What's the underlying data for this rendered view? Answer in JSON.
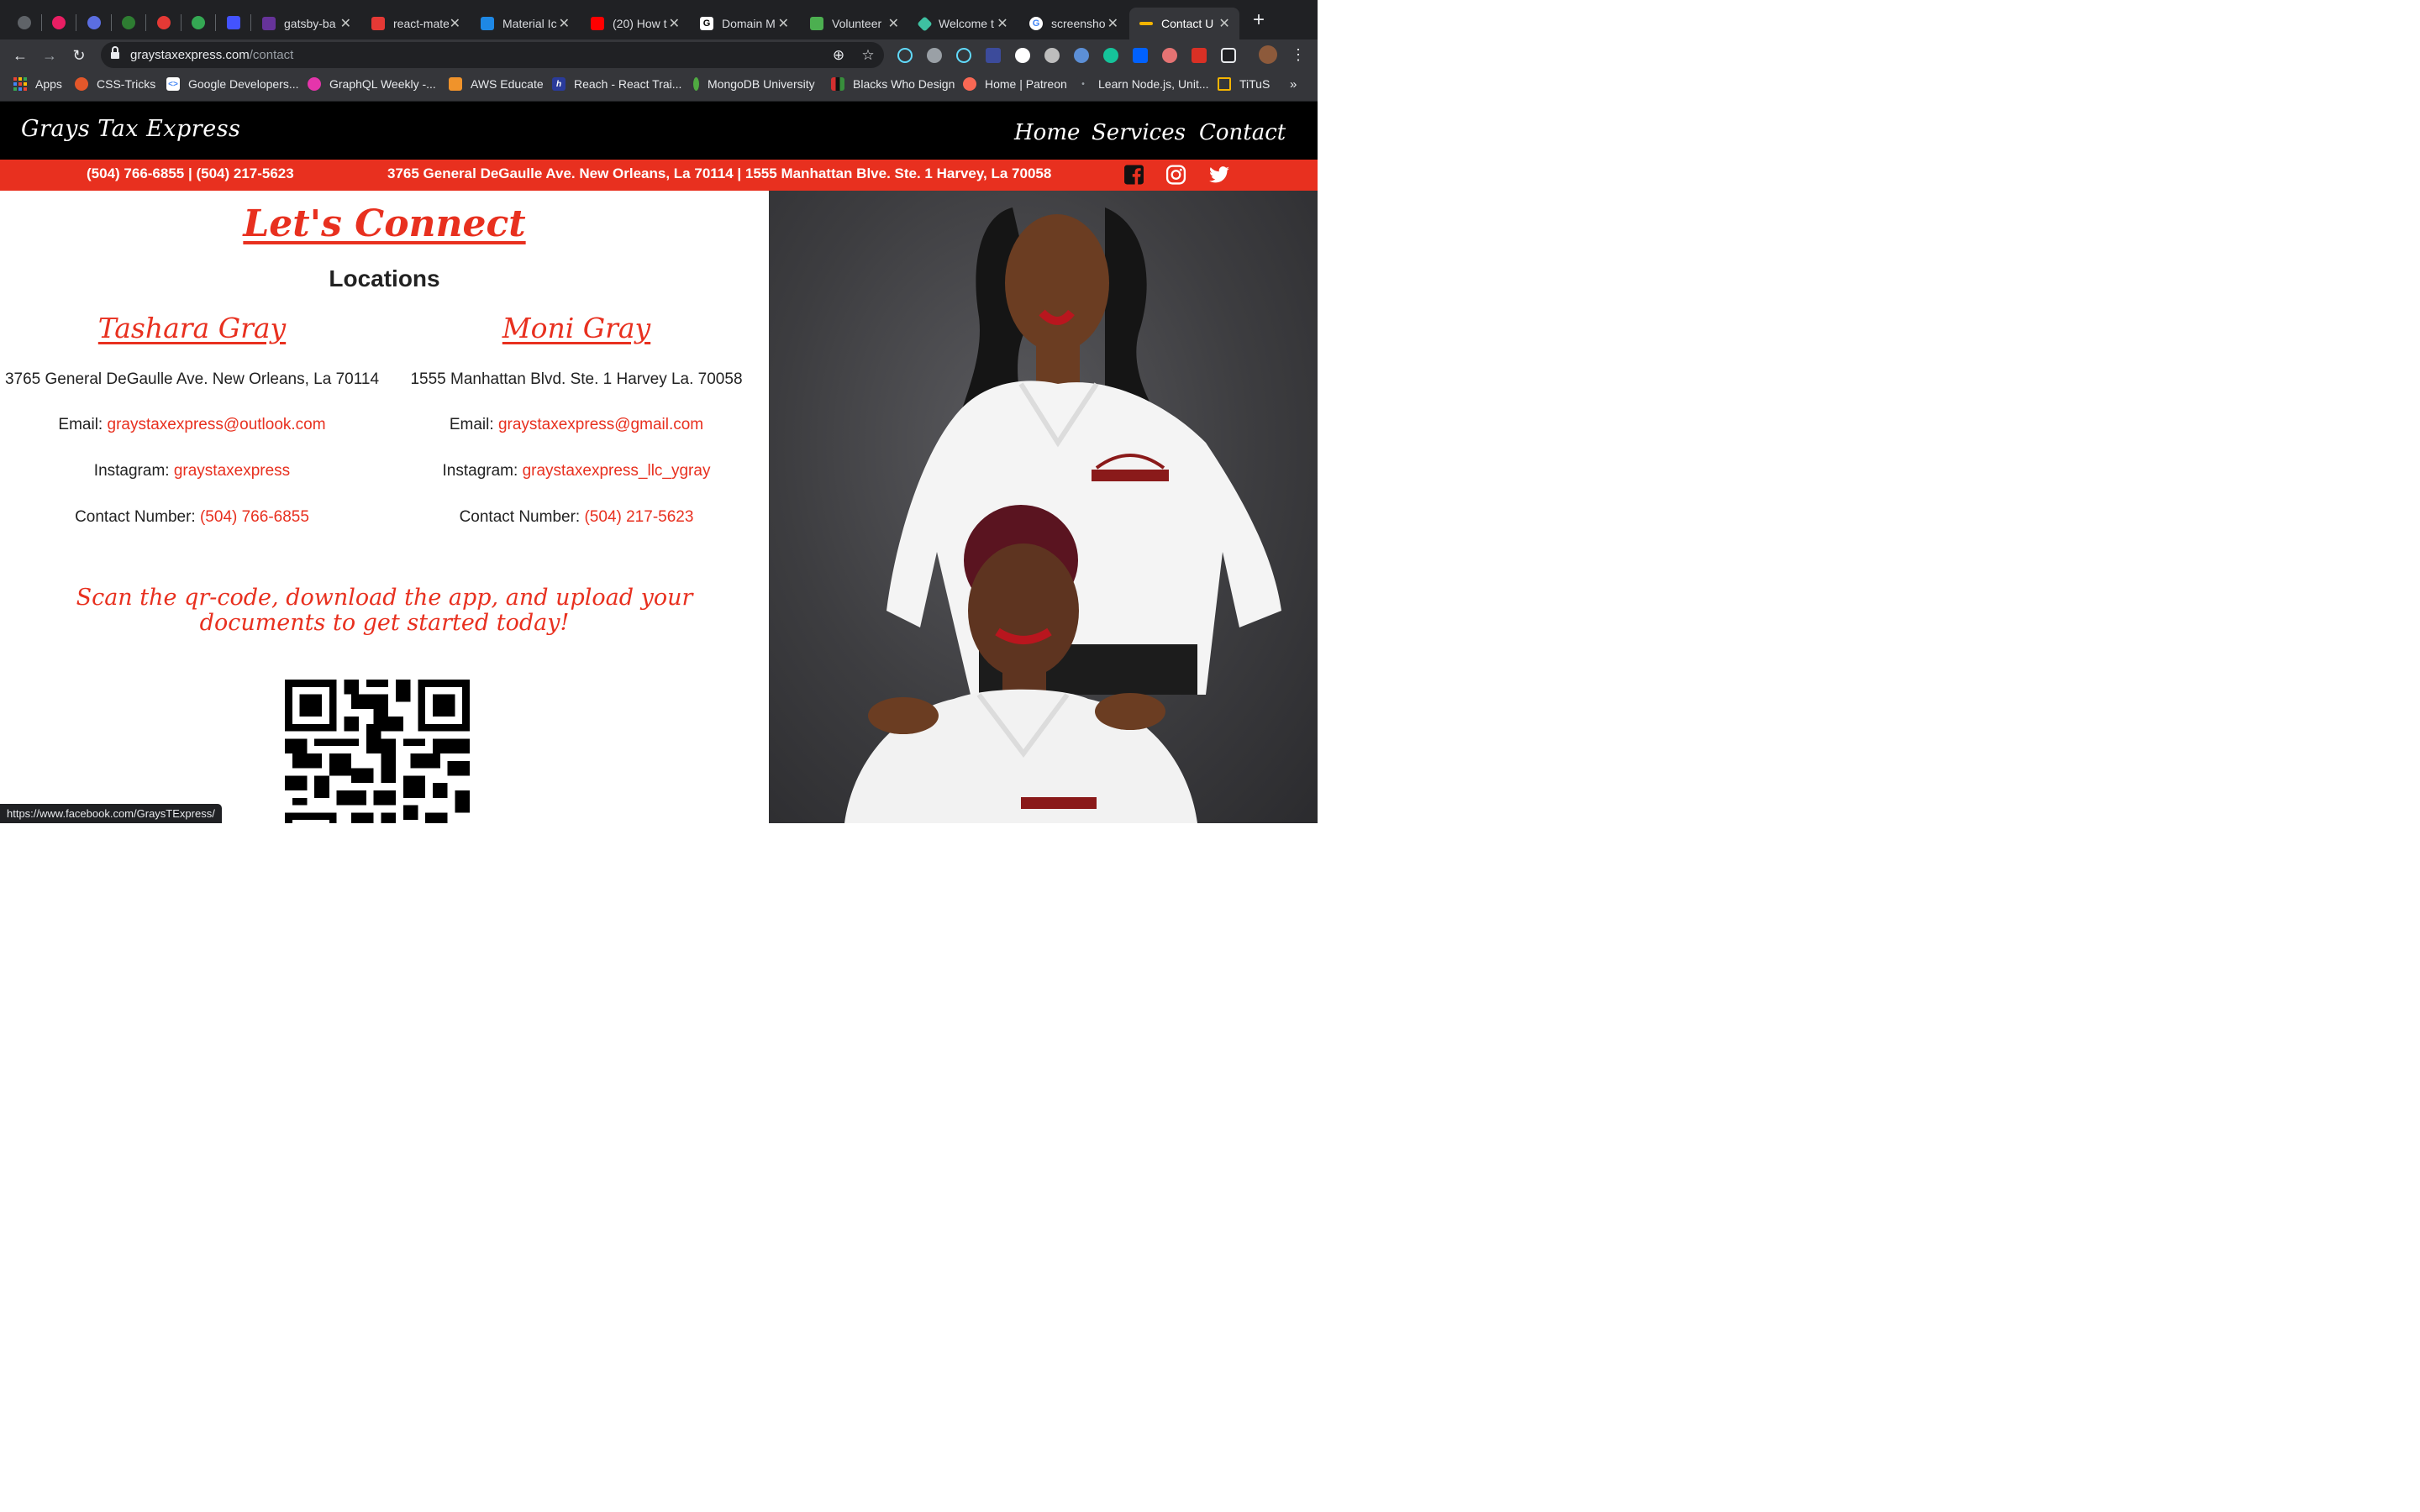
{
  "browser": {
    "tabs": [
      {
        "title": "gatsby-ba",
        "color": "#663399"
      },
      {
        "title": "react-mate",
        "color": "#e53935"
      },
      {
        "title": "Material Ic",
        "color": "#1e88e5"
      },
      {
        "title": "(20) How t",
        "color": "#ff0000"
      },
      {
        "title": "Domain M",
        "color": "#ffffff"
      },
      {
        "title": "Volunteer",
        "color": "#4caf50"
      },
      {
        "title": "Welcome t",
        "color": "#3ec1a2"
      },
      {
        "title": "screensho",
        "color": "#ffffff"
      },
      {
        "title": "Contact U",
        "color": "#f4b400"
      }
    ],
    "new_tab_label": "+",
    "url_host": "graystaxexpress.com",
    "url_path": "/contact",
    "bookmarks": [
      {
        "label": "Apps"
      },
      {
        "label": "CSS-Tricks"
      },
      {
        "label": "Google Developers..."
      },
      {
        "label": "GraphQL Weekly -..."
      },
      {
        "label": "AWS Educate"
      },
      {
        "label": "Reach - React Trai..."
      },
      {
        "label": "MongoDB University"
      },
      {
        "label": "Blacks Who Design"
      },
      {
        "label": "Home | Patreon"
      },
      {
        "label": "Learn Node.js, Unit..."
      },
      {
        "label": "TiTuS"
      }
    ],
    "bookmarks_overflow": "»",
    "status_url": "https://www.facebook.com/GraysTExpress/"
  },
  "site": {
    "logo": "Grays Tax Express",
    "nav": [
      {
        "label": "Home"
      },
      {
        "label": "Services"
      },
      {
        "label": "Contact"
      }
    ],
    "info_phones": "(504) 766-6855 | (504) 217-5623",
    "info_address": "3765 General DeGaulle Ave. New Orleans, La 70114 | 1555 Manhattan Blve. Ste. 1 Harvey, La 70058",
    "colors": {
      "accent": "#e8301f",
      "header": "#000000"
    }
  },
  "contact": {
    "title": "Let's Connect",
    "locations_heading": "Locations",
    "locations": [
      {
        "name": "Tashara Gray",
        "address": "3765 General DeGaulle Ave. New Orleans, La 70114",
        "email_label": "Email: ",
        "email": "graystaxexpress@outlook.com",
        "instagram_label": "Instagram: ",
        "instagram": "graystaxexpress",
        "phone_label": "Contact Number: ",
        "phone": "(504) 766-6855"
      },
      {
        "name": "Moni Gray",
        "address": "1555 Manhattan Blvd. Ste. 1 Harvey La. 70058",
        "email_label": "Email: ",
        "email": "graystaxexpress@gmail.com",
        "instagram_label": "Instagram: ",
        "instagram": "graystaxexpress_llc_ygray",
        "phone_label": "Contact Number: ",
        "phone": "(504) 217-5623"
      }
    ],
    "scan_text": "Scan the qr-code, download the app, and upload your documents to get started today!"
  }
}
